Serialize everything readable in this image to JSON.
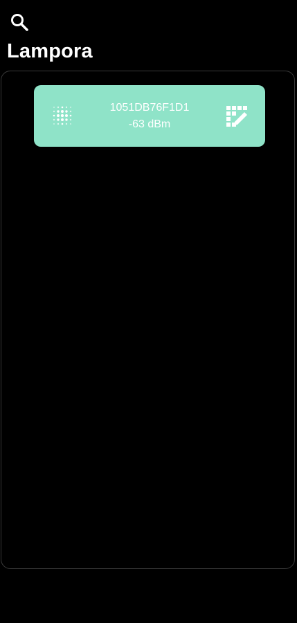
{
  "header": {
    "search_icon": "search-icon",
    "title": "Lampora"
  },
  "devices": [
    {
      "id": "1051DB76F1D1",
      "signal": "-63 dBm",
      "icon": "dot-matrix-icon",
      "action_icon": "grid-edit-icon"
    }
  ],
  "colors": {
    "background": "#000000",
    "card": "#8fe3c8",
    "text": "#ffffff",
    "panel_border": "#3a3a3a"
  }
}
